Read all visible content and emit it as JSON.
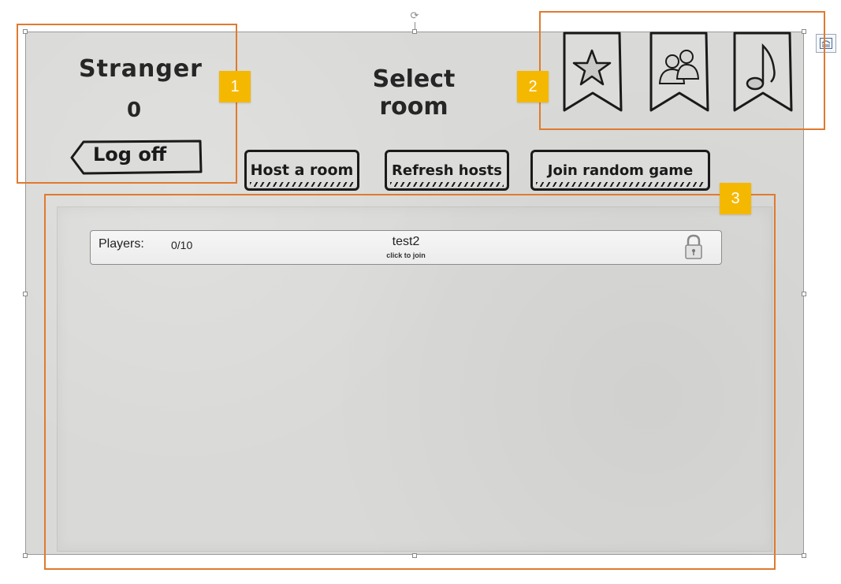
{
  "user": {
    "name": "Stranger",
    "score": "0",
    "logoff_label": "Log off"
  },
  "page": {
    "title": "Select room"
  },
  "toolbar": {
    "host_label": "Host a room",
    "refresh_label": "Refresh hosts",
    "random_label": "Join random game"
  },
  "banners": [
    {
      "icon": "star-icon"
    },
    {
      "icon": "friends-icon"
    },
    {
      "icon": "music-note-icon"
    }
  ],
  "rooms": [
    {
      "players_label": "Players:",
      "players_count": "0/10",
      "name": "test2",
      "hint": "click to join",
      "icon": "lock-icon"
    }
  ],
  "callouts": [
    {
      "number": "1"
    },
    {
      "number": "2"
    },
    {
      "number": "3"
    }
  ],
  "colors": {
    "callout_border": "#e07a2e",
    "callout_badge": "#f5b800",
    "paper": "#d9d9d7"
  }
}
